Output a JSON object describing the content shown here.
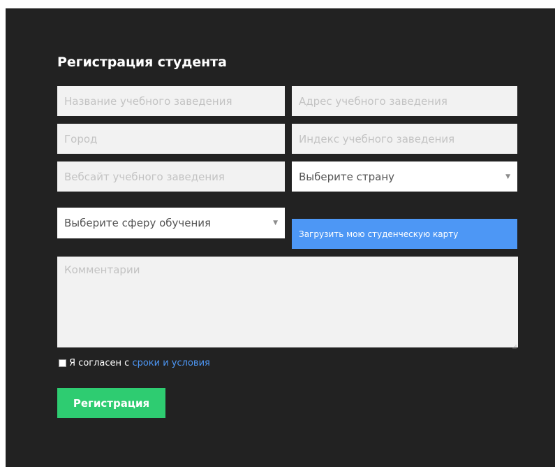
{
  "form": {
    "title": "Регистрация студента",
    "institution_name": {
      "placeholder": "Название учебного заведения"
    },
    "institution_address": {
      "placeholder": "Адрес учебного заведения"
    },
    "city": {
      "placeholder": "Город"
    },
    "institution_index": {
      "placeholder": "Индекс учебного заведения"
    },
    "institution_website": {
      "placeholder": "Вебсайт учебного заведения"
    },
    "country_select": {
      "selected": "Выберите страну",
      "arrow": "▼"
    },
    "field_of_study_select": {
      "selected": "Выберите сферу обучения",
      "arrow": "▼"
    },
    "upload_button_label": "Загрузить мою студенческую карту",
    "comments": {
      "placeholder": "Комментарии"
    },
    "agree": {
      "prefix": "Я согласен с",
      "link_text": "сроки и условия",
      "checked": false
    },
    "submit_label": "Регистрация"
  },
  "colors": {
    "panel_bg": "#222222",
    "field_bg": "#f2f2f2",
    "upload_blue": "#4d97f5",
    "submit_green": "#2ecc71",
    "link_blue": "#4d97f5"
  }
}
